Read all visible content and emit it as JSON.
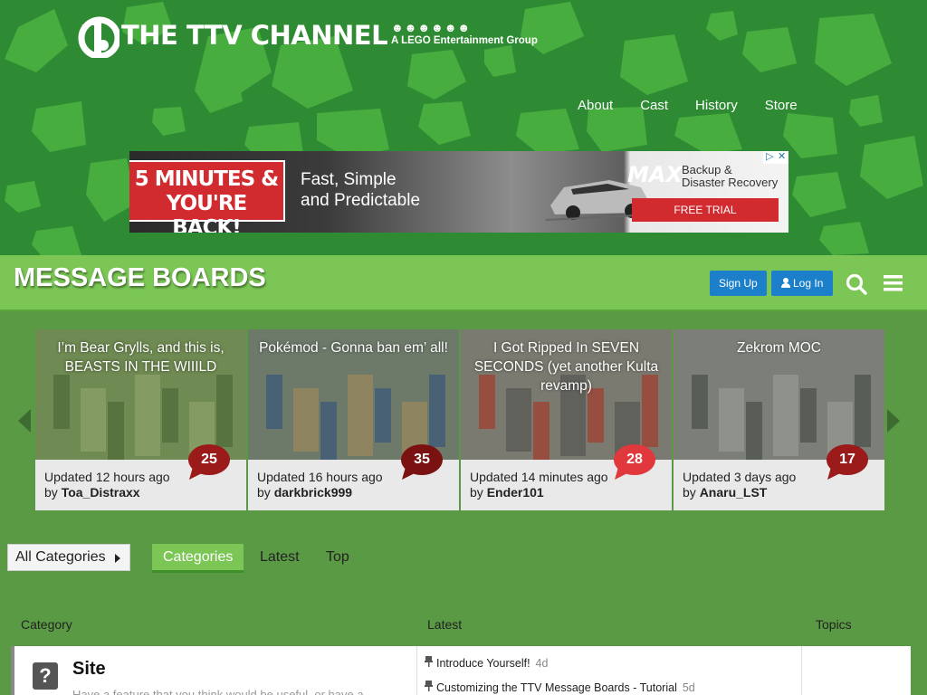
{
  "brand": {
    "title": "THE TTV CHANNEL",
    "group": "A LEGO Entertainment Group",
    "group_heads": "☻☻☻☻☻☻"
  },
  "topnav": [
    "About",
    "Cast",
    "History",
    "Store"
  ],
  "ad": {
    "headline_1": "5 MINUTES &",
    "headline_2": "YOU'RE BACK!",
    "tagline_1": "Fast, Simple",
    "tagline_2": "and Predictable",
    "brand": "MAX",
    "product_1": "Backup &",
    "product_2": "Disaster Recovery",
    "cta": "FREE TRIAL"
  },
  "banner": {
    "title": "MESSAGE BOARDS",
    "signup": "Sign Up",
    "login": "Log In"
  },
  "featured": [
    {
      "title": "I’m Bear Grylls, and this is, BEASTS IN THE WIIILD",
      "updated": "Updated 12 hours ago",
      "by": "by",
      "author": "Toa_Distraxx",
      "count": "25",
      "bubble": "#9b1a1a"
    },
    {
      "title": "Pokémod - Gonna ban em’ all!",
      "updated": "Updated 16 hours ago",
      "by": "by",
      "author": "darkbrick999",
      "count": "35",
      "bubble": "#7a1212"
    },
    {
      "title": "I Got Ripped In SEVEN SECONDS (yet another Kulta revamp)",
      "updated": "Updated 14 minutes ago",
      "by": "by",
      "author": "Ender101",
      "count": "28",
      "bubble": "#e0383c"
    },
    {
      "title": "Zekrom MOC",
      "updated": "Updated 3 days ago",
      "by": "by",
      "author": "Anaru_LST",
      "count": "17",
      "bubble": "#9b1a1a"
    }
  ],
  "filters": {
    "all_categories": "All Categories",
    "tabs": [
      "Categories",
      "Latest",
      "Top"
    ]
  },
  "table": {
    "headers": {
      "category": "Category",
      "latest": "Latest",
      "topics": "Topics"
    },
    "rows": [
      {
        "name": "Site",
        "icon": "?",
        "description": "Have a feature that you think would be useful, or have a",
        "latest": [
          {
            "title": "Introduce Yourself!",
            "age": "4d"
          },
          {
            "title": "Customizing the TTV Message Boards - Tutorial",
            "age": "5d"
          }
        ]
      }
    ]
  }
}
